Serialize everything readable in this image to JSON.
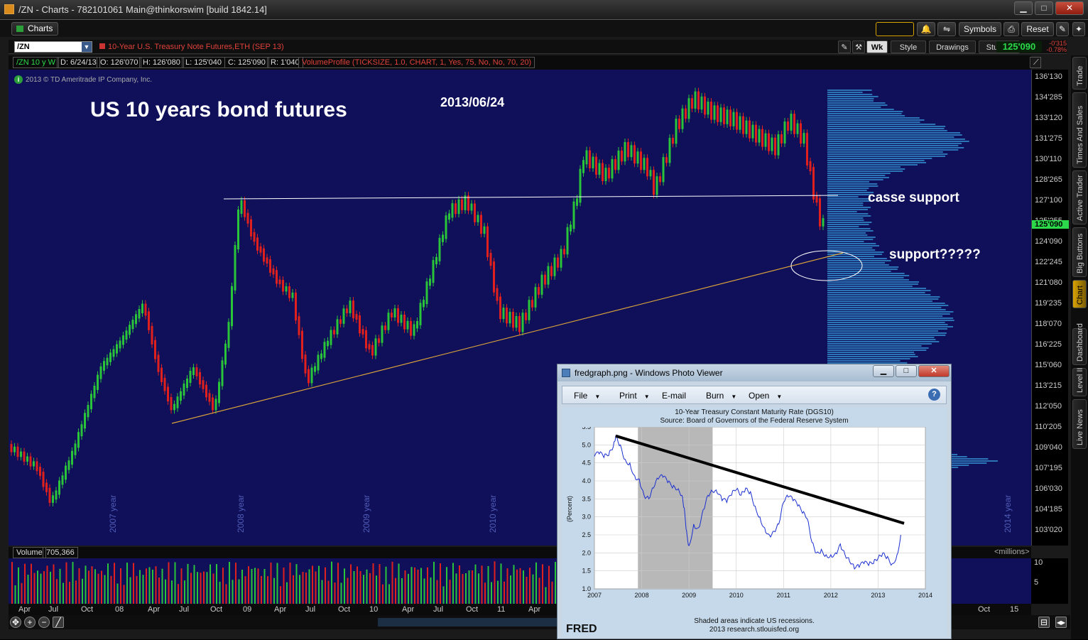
{
  "window": {
    "title": "/ZN - Charts - 782101061 Main@thinkorswim [build 1842.14]",
    "min": "▁",
    "max": "□",
    "close": "✕"
  },
  "toolbar": {
    "charts_tab": "Charts",
    "symbols": "Symbols",
    "reset": "Reset"
  },
  "symbol_row": {
    "symbol": "/ZN",
    "description": "10-Year U.S. Treasury Note Futures,ETH (SEP 13)",
    "aggregation": "Wk",
    "style": "Style",
    "drawings": "Drawings",
    "studies": "Studies",
    "last_price": "125'090",
    "change": "-0'315",
    "change_pct": "-0.78%"
  },
  "info_row": {
    "symbol": "/ZN 10 y W",
    "date": "D: 6/24/13",
    "open": "O: 126'070",
    "high": "H: 126'080",
    "low": "L: 125'040",
    "close": "C: 125'090",
    "range": "R: 1'040",
    "study": "VolumeProfile (TICKSIZE, 1.0, CHART, 1, Yes, 75, No, No, 70, 20)"
  },
  "chart": {
    "watermark": "2013 © TD Ameritrade IP Company, Inc.",
    "watermark_icon": "i",
    "annotation_title": "US 10 years bond futures",
    "annotation_date": "2013/06/24",
    "annotation_break": "casse support",
    "annotation_support": "support?????",
    "year_labels": [
      "2007 year",
      "2008 year",
      "2009 year",
      "2010 year",
      "2014 year"
    ],
    "price_labels": [
      "136'130",
      "134'285",
      "133'120",
      "131'275",
      "130'110",
      "128'265",
      "127'100",
      "125'255",
      "124'090",
      "122'245",
      "121'080",
      "119'235",
      "118'070",
      "116'225",
      "115'060",
      "113'215",
      "112'050",
      "110'205",
      "109'040",
      "107'195",
      "106'030",
      "104'185",
      "103'020"
    ],
    "current_price": "125'090"
  },
  "volume": {
    "label": "Volume",
    "value": "705,366",
    "units": "<millions>",
    "axis": [
      "10",
      "5"
    ]
  },
  "dates": [
    "Apr",
    "Jul",
    "Oct",
    "08",
    "Apr",
    "Jul",
    "Oct",
    "09",
    "Apr",
    "Jul",
    "Oct",
    "10",
    "Apr",
    "Jul",
    "Oct",
    "11",
    "Apr",
    "Oct",
    "15"
  ],
  "sidebar": {
    "tabs": [
      "Trade",
      "Times And Sales",
      "Active Trader",
      "Big Buttons",
      "Chart",
      "Dashboard",
      "Level II",
      "Live News"
    ]
  },
  "photo_viewer": {
    "title": "fredgraph.png - Windows Photo Viewer",
    "menu": [
      "File",
      "Print",
      "E-mail",
      "Burn",
      "Open"
    ],
    "help": "?",
    "chart_title": "10-Year Treasury Constant Maturity Rate (DGS10)",
    "chart_source": "Source: Board of Governors of the Federal Reserve System",
    "footer1": "Shaded areas indicate US recessions.",
    "footer2": "2013 research.stlouisfed.org",
    "logo": "FRED"
  },
  "chart_data": {
    "type": "line",
    "ylabel": "(Percent)",
    "ylim": [
      1.0,
      5.5
    ],
    "xlim": [
      2007,
      2014
    ],
    "x_ticks": [
      "2007",
      "2008",
      "2009",
      "2010",
      "2011",
      "2012",
      "2013",
      "2014"
    ],
    "y_ticks": [
      "5.5",
      "5.0",
      "4.5",
      "4.0",
      "3.5",
      "3.0",
      "2.5",
      "2.0",
      "1.5",
      "1.0"
    ],
    "recession": [
      2007.92,
      2009.5
    ],
    "trend": {
      "x": [
        2007.45,
        2013.55
      ],
      "y": [
        5.25,
        2.82
      ]
    },
    "series": [
      {
        "x": [
          2007.0,
          2007.1,
          2007.2,
          2007.3,
          2007.4,
          2007.45,
          2007.55,
          2007.65,
          2007.75,
          2007.85,
          2007.95,
          2008.05,
          2008.15,
          2008.25,
          2008.35,
          2008.45,
          2008.55,
          2008.65,
          2008.75,
          2008.85,
          2008.9,
          2008.95,
          2009.0,
          2009.1,
          2009.2,
          2009.3,
          2009.4,
          2009.5,
          2009.6,
          2009.7,
          2009.8,
          2009.9,
          2010.0,
          2010.1,
          2010.2,
          2010.3,
          2010.4,
          2010.5,
          2010.6,
          2010.7,
          2010.8,
          2010.9,
          2011.0,
          2011.1,
          2011.2,
          2011.3,
          2011.4,
          2011.5,
          2011.6,
          2011.7,
          2011.8,
          2011.9,
          2012.0,
          2012.1,
          2012.2,
          2012.3,
          2012.4,
          2012.5,
          2012.6,
          2012.7,
          2012.8,
          2012.9,
          2013.0,
          2013.1,
          2013.2,
          2013.3,
          2013.4,
          2013.48
        ],
        "y": [
          4.68,
          4.75,
          4.65,
          4.7,
          4.95,
          5.25,
          5.0,
          4.6,
          4.5,
          4.15,
          4.05,
          3.6,
          3.5,
          3.8,
          4.05,
          4.1,
          3.95,
          3.8,
          3.75,
          3.6,
          3.25,
          2.6,
          2.2,
          2.8,
          2.7,
          3.2,
          3.6,
          3.7,
          3.65,
          3.45,
          3.4,
          3.6,
          3.75,
          3.6,
          3.8,
          3.7,
          3.3,
          3.0,
          2.7,
          2.5,
          2.6,
          2.8,
          3.4,
          3.55,
          3.45,
          3.3,
          3.1,
          2.95,
          2.3,
          2.0,
          2.1,
          1.95,
          1.95,
          2.0,
          2.25,
          1.95,
          1.75,
          1.55,
          1.6,
          1.7,
          1.65,
          1.7,
          1.85,
          2.0,
          1.9,
          1.7,
          1.95,
          2.5
        ]
      }
    ]
  }
}
